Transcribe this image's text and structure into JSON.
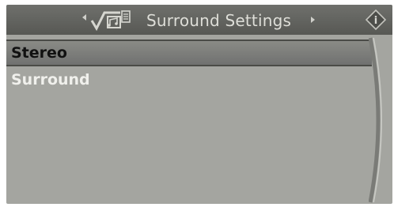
{
  "header": {
    "title": "Surround Settings",
    "icon": "music-notes-icon",
    "info_icon": "info-icon"
  },
  "options": [
    {
      "label": "Stereo",
      "selected": true
    },
    {
      "label": "Surround",
      "selected": false
    }
  ],
  "colors": {
    "panel": "#a4a5a0",
    "title_bar": "#63645f",
    "selection": "#7c7d79"
  }
}
